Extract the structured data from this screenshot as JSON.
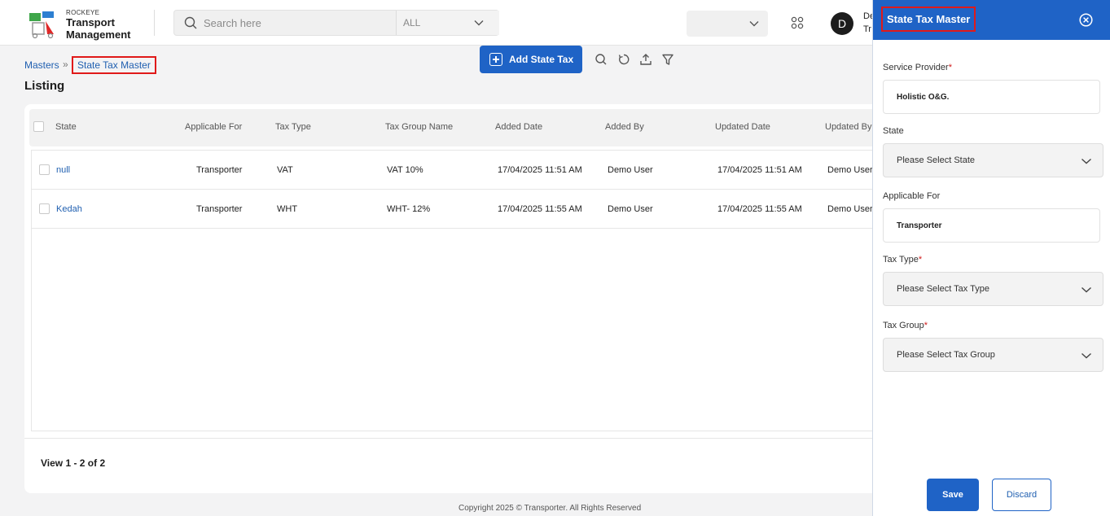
{
  "header": {
    "brand_small": "ROCKEYE",
    "brand_line1": "Transport",
    "brand_line2": "Management",
    "search_placeholder": "Search here",
    "search_scope": "ALL",
    "avatar_initial": "D",
    "user_line1": "De",
    "user_line2": "Tr"
  },
  "breadcrumb": {
    "root": "Masters",
    "separator": "»",
    "current": "State Tax Master"
  },
  "page": {
    "title": "Listing"
  },
  "toolbar": {
    "add_label": "Add State Tax"
  },
  "table": {
    "columns": [
      "State",
      "Applicable For",
      "Tax Type",
      "Tax Group Name",
      "Added Date",
      "Added By",
      "Updated Date",
      "Updated By"
    ],
    "rows": [
      [
        "null",
        "Transporter",
        "VAT",
        "VAT 10%",
        "17/04/2025 11:51 AM",
        "Demo User",
        "17/04/2025 11:51 AM",
        "Demo User"
      ],
      [
        "Kedah",
        "Transporter",
        "WHT",
        "WHT- 12%",
        "17/04/2025 11:55 AM",
        "Demo User",
        "17/04/2025 11:55 AM",
        "Demo User"
      ]
    ],
    "view_count": "View 1 - 2 of 2"
  },
  "footer": {
    "copyright": "Copyright 2025 © Transporter. All Rights Reserved"
  },
  "panel": {
    "title": "State Tax Master",
    "service_provider": {
      "label": "Service Provider",
      "required_mark": "*",
      "value": "Holistic O&G."
    },
    "state": {
      "label": "State",
      "placeholder": "Please Select State"
    },
    "applicable_for": {
      "label": "Applicable For",
      "value": "Transporter"
    },
    "tax_type": {
      "label": "Tax Type",
      "required_mark": "*",
      "placeholder": "Please Select Tax Type"
    },
    "tax_group": {
      "label": "Tax Group",
      "required_mark": "*",
      "placeholder": "Please Select Tax Group"
    },
    "save_label": "Save",
    "discard_label": "Discard"
  },
  "colors": {
    "primary": "#1f63c6",
    "link": "#1f5fb0",
    "highlight": "#e01919",
    "required": "#d11a1a"
  },
  "icons": [
    "logo-icon",
    "search-icon",
    "chevron-down-icon",
    "apps-grid-icon",
    "plus-icon",
    "refresh-icon",
    "upload-icon",
    "filter-icon",
    "close-circle-icon"
  ]
}
